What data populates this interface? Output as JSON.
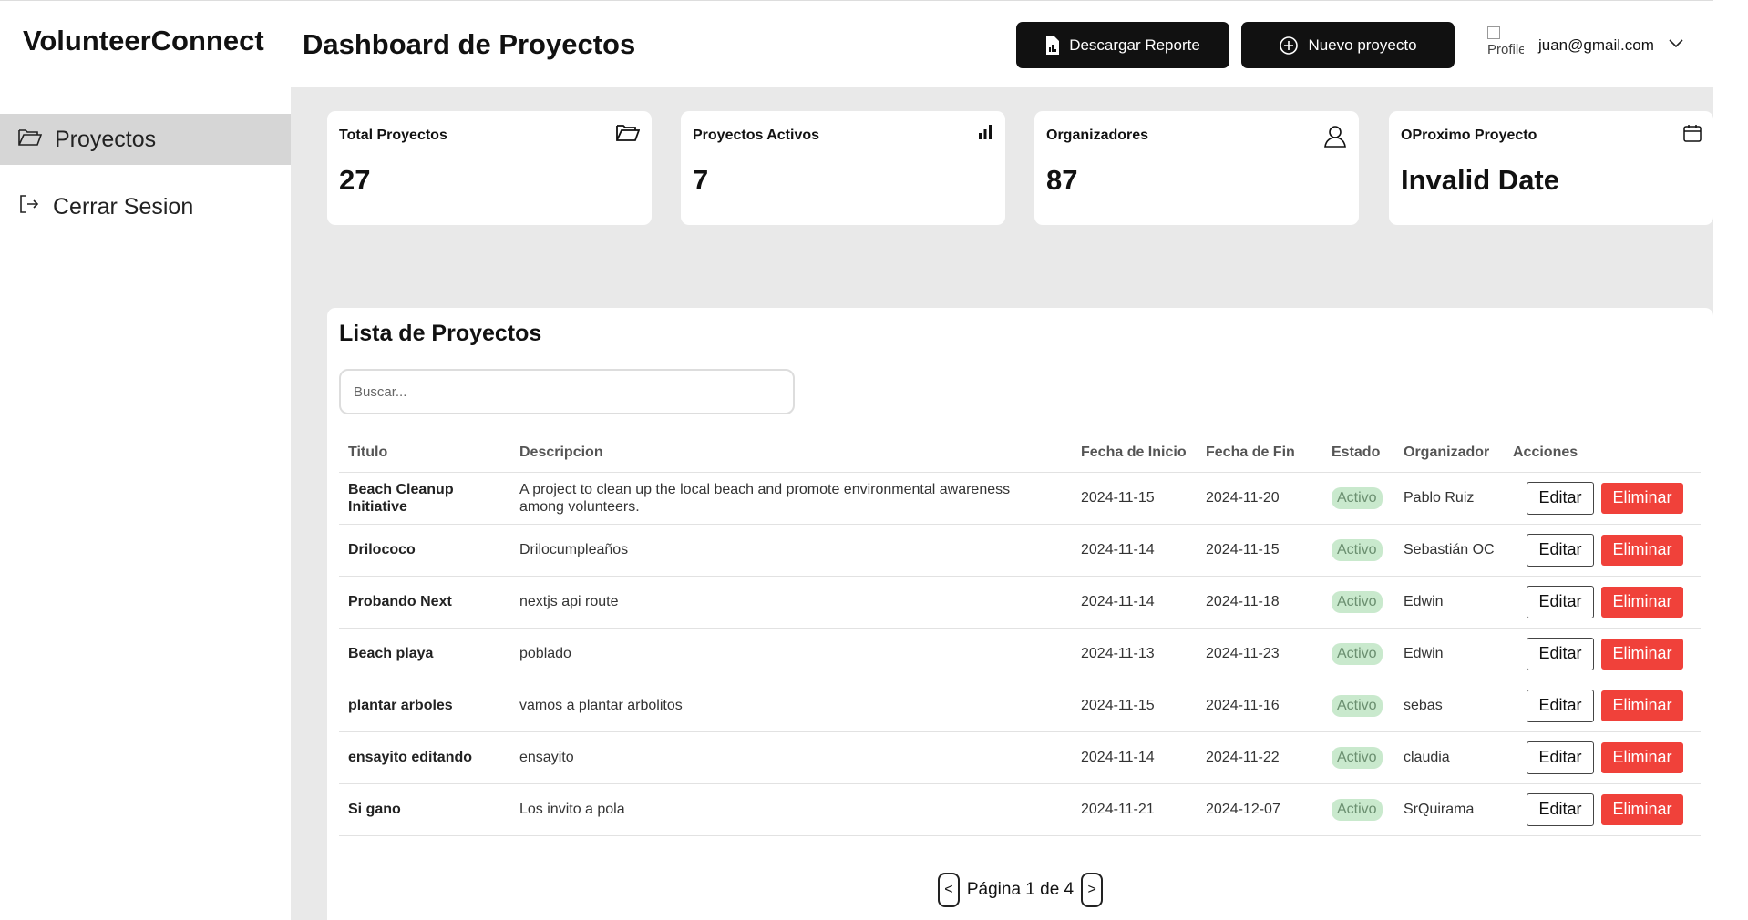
{
  "header": {
    "brand": "VolunteerConnect",
    "title": "Dashboard de Proyectos",
    "report_button": "Descargar Reporte",
    "new_button": "Nuevo proyecto",
    "profile_alt": "Profile",
    "user_email": "juan@gmail.com"
  },
  "sidebar": {
    "items": [
      {
        "label": "Proyectos",
        "icon": "folder-open-icon",
        "active": true
      },
      {
        "label": "Cerrar Sesion",
        "icon": "logout-icon",
        "active": false
      }
    ]
  },
  "stats": [
    {
      "title": "Total Proyectos",
      "value": "27",
      "icon": "folder-open-icon"
    },
    {
      "title": "Proyectos Activos",
      "value": "7",
      "icon": "bar-chart-icon"
    },
    {
      "title": "Organizadores",
      "value": "87",
      "icon": "user-icon"
    },
    {
      "title": "OProximo Proyecto",
      "value": "Invalid Date",
      "icon": "calendar-icon"
    }
  ],
  "list": {
    "title": "Lista de Proyectos",
    "search_placeholder": "Buscar...",
    "columns": {
      "title": "Titulo",
      "description": "Descripcion",
      "start": "Fecha de Inicio",
      "end": "Fecha de Fin",
      "state": "Estado",
      "organizer": "Organizador",
      "actions": "Acciones"
    },
    "edit_label": "Editar",
    "delete_label": "Eliminar",
    "rows": [
      {
        "title": "Beach Cleanup Initiative",
        "description": "A project to clean up the local beach and promote environmental awareness among volunteers.",
        "start": "2024-11-15",
        "end": "2024-11-20",
        "state": "Activo",
        "organizer": "Pablo Ruiz"
      },
      {
        "title": "Drilococo",
        "description": "Drilocumpleaños",
        "start": "2024-11-14",
        "end": "2024-11-15",
        "state": "Activo",
        "organizer": "Sebastián OC"
      },
      {
        "title": "Probando Next",
        "description": "nextjs api route",
        "start": "2024-11-14",
        "end": "2024-11-18",
        "state": "Activo",
        "organizer": "Edwin"
      },
      {
        "title": "Beach playa",
        "description": "poblado",
        "start": "2024-11-13",
        "end": "2024-11-23",
        "state": "Activo",
        "organizer": "Edwin"
      },
      {
        "title": "plantar arboles",
        "description": "vamos a plantar arbolitos",
        "start": "2024-11-15",
        "end": "2024-11-16",
        "state": "Activo",
        "organizer": "sebas"
      },
      {
        "title": "ensayito editando",
        "description": "ensayito",
        "start": "2024-11-14",
        "end": "2024-11-22",
        "state": "Activo",
        "organizer": "claudia"
      },
      {
        "title": "Si gano",
        "description": "Los invito a pola",
        "start": "2024-11-21",
        "end": "2024-12-07",
        "state": "Activo",
        "organizer": "SrQuirama"
      }
    ]
  },
  "pagination": {
    "prev": "<",
    "next": ">",
    "label": "Página 1 de 4"
  },
  "colors": {
    "dark": "#111111",
    "danger": "#f0413a",
    "badge_bg": "#c9e9cd",
    "badge_text": "#6b8f70",
    "page_bg": "#e9e9e9",
    "sidebar_active": "#d6d6d6"
  }
}
